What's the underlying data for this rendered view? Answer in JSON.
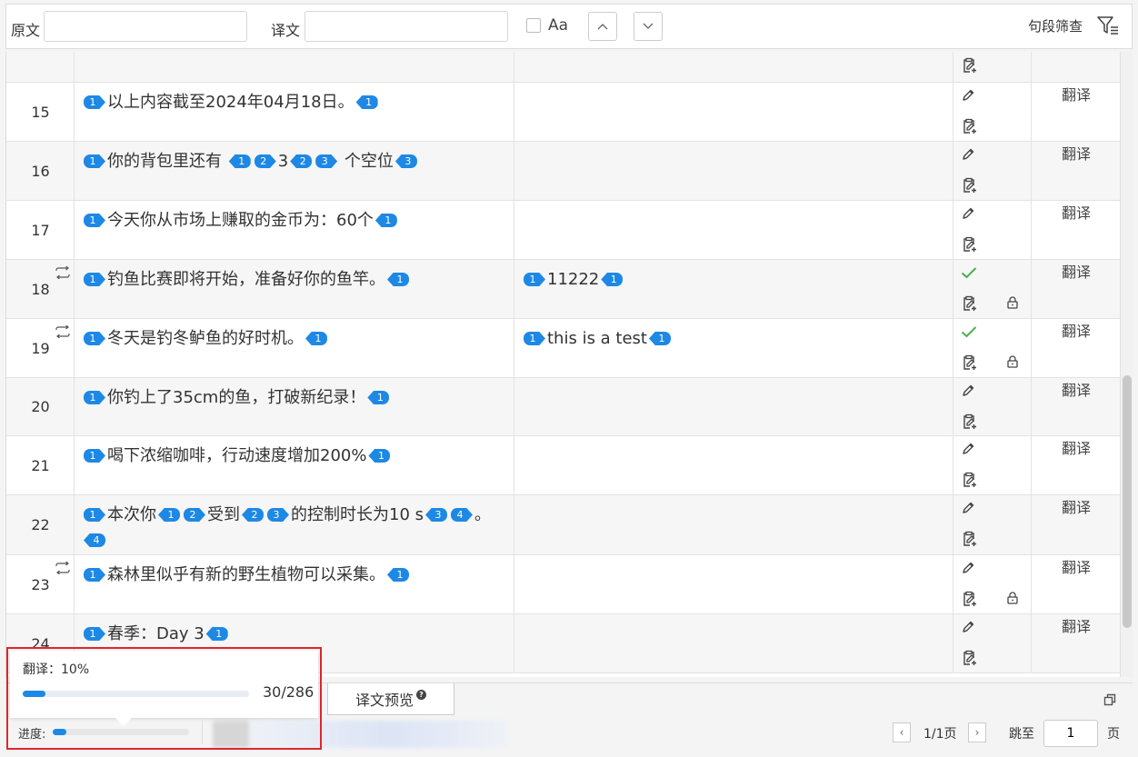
{
  "search": {
    "source_label": "原文",
    "source_value": "",
    "target_label": "译文",
    "target_value": "",
    "case_label": "Aa",
    "case_checked": false,
    "filter_label": "句段筛查"
  },
  "rows": [
    {
      "num": "",
      "src": [],
      "tgt": [],
      "status": "none",
      "locked": false,
      "repeat": false,
      "action": ""
    },
    {
      "num": "15",
      "src": [
        {
          "t": "open",
          "v": "1"
        },
        {
          "v": "以上内容截至2024年04月18日。"
        },
        {
          "t": "close",
          "v": "1"
        }
      ],
      "tgt": [],
      "status": "edit",
      "locked": false,
      "repeat": false,
      "action": "翻译"
    },
    {
      "num": "16",
      "src": [
        {
          "t": "open",
          "v": "1"
        },
        {
          "v": "你的背包里还有 "
        },
        {
          "t": "close",
          "v": "1"
        },
        {
          "t": "open",
          "v": "2"
        },
        {
          "v": "3"
        },
        {
          "t": "close",
          "v": "2"
        },
        {
          "t": "open",
          "v": "3"
        },
        {
          "v": " 个空位"
        },
        {
          "t": "close",
          "v": "3"
        }
      ],
      "tgt": [],
      "status": "edit",
      "locked": false,
      "repeat": false,
      "action": "翻译"
    },
    {
      "num": "17",
      "src": [
        {
          "t": "open",
          "v": "1"
        },
        {
          "v": "今天你从市场上赚取的金币为：60个"
        },
        {
          "t": "close",
          "v": "1"
        }
      ],
      "tgt": [],
      "status": "edit",
      "locked": false,
      "repeat": false,
      "action": "翻译"
    },
    {
      "num": "18",
      "src": [
        {
          "t": "open",
          "v": "1"
        },
        {
          "v": "钓鱼比赛即将开始，准备好你的鱼竿。"
        },
        {
          "t": "close",
          "v": "1"
        }
      ],
      "tgt": [
        {
          "t": "open",
          "v": "1"
        },
        {
          "v": "11222"
        },
        {
          "t": "close",
          "v": "1"
        }
      ],
      "status": "done",
      "locked": true,
      "repeat": true,
      "action": "翻译"
    },
    {
      "num": "19",
      "src": [
        {
          "t": "open",
          "v": "1"
        },
        {
          "v": "冬天是钓冬鲈鱼的好时机。"
        },
        {
          "t": "close",
          "v": "1"
        }
      ],
      "tgt": [
        {
          "t": "open",
          "v": "1"
        },
        {
          "v": "this is a test"
        },
        {
          "t": "close",
          "v": "1"
        }
      ],
      "status": "done",
      "locked": true,
      "repeat": true,
      "action": "翻译"
    },
    {
      "num": "20",
      "src": [
        {
          "t": "open",
          "v": "1"
        },
        {
          "v": "你钓上了35cm的鱼，打破新纪录！"
        },
        {
          "t": "close",
          "v": "1"
        }
      ],
      "tgt": [],
      "status": "edit",
      "locked": false,
      "repeat": false,
      "action": "翻译"
    },
    {
      "num": "21",
      "src": [
        {
          "t": "open",
          "v": "1"
        },
        {
          "v": "喝下浓缩咖啡，行动速度增加200%"
        },
        {
          "t": "close",
          "v": "1"
        }
      ],
      "tgt": [],
      "status": "edit",
      "locked": false,
      "repeat": false,
      "action": "翻译"
    },
    {
      "num": "22",
      "src": [
        {
          "t": "open",
          "v": "1"
        },
        {
          "v": "本次你"
        },
        {
          "t": "close",
          "v": "1"
        },
        {
          "t": "open",
          "v": "2"
        },
        {
          "v": "受到"
        },
        {
          "t": "close",
          "v": "2"
        },
        {
          "t": "open",
          "v": "3"
        },
        {
          "v": "的控制时长为10 s"
        },
        {
          "t": "close",
          "v": "3"
        },
        {
          "t": "open",
          "v": "4"
        },
        {
          "v": "。"
        },
        {
          "t": "close",
          "v": "4"
        }
      ],
      "tgt": [],
      "status": "edit",
      "locked": false,
      "repeat": false,
      "action": "翻译"
    },
    {
      "num": "23",
      "src": [
        {
          "t": "open",
          "v": "1"
        },
        {
          "v": "森林里似乎有新的野生植物可以采集。"
        },
        {
          "t": "close",
          "v": "1"
        }
      ],
      "tgt": [],
      "status": "edit",
      "locked": true,
      "repeat": true,
      "action": "翻译"
    },
    {
      "num": "24",
      "src": [
        {
          "t": "open",
          "v": "1"
        },
        {
          "v": "春季：Day 3"
        },
        {
          "t": "close",
          "v": "1"
        }
      ],
      "tgt": [],
      "status": "edit",
      "locked": false,
      "repeat": false,
      "action": "翻译"
    }
  ],
  "tab": {
    "label": "译文预览"
  },
  "footer": {
    "progress_label": "进度:",
    "progress_fraction": 0.1,
    "page_info": "1/1页",
    "goto_label": "跳至",
    "goto_value": "1",
    "page_unit": "页"
  },
  "popup": {
    "title": "翻译：10%",
    "fraction": 0.1,
    "count": "30/286"
  },
  "colors": {
    "accent": "#1e88e5",
    "check": "#4caf50",
    "highlight": "#e0262b"
  }
}
